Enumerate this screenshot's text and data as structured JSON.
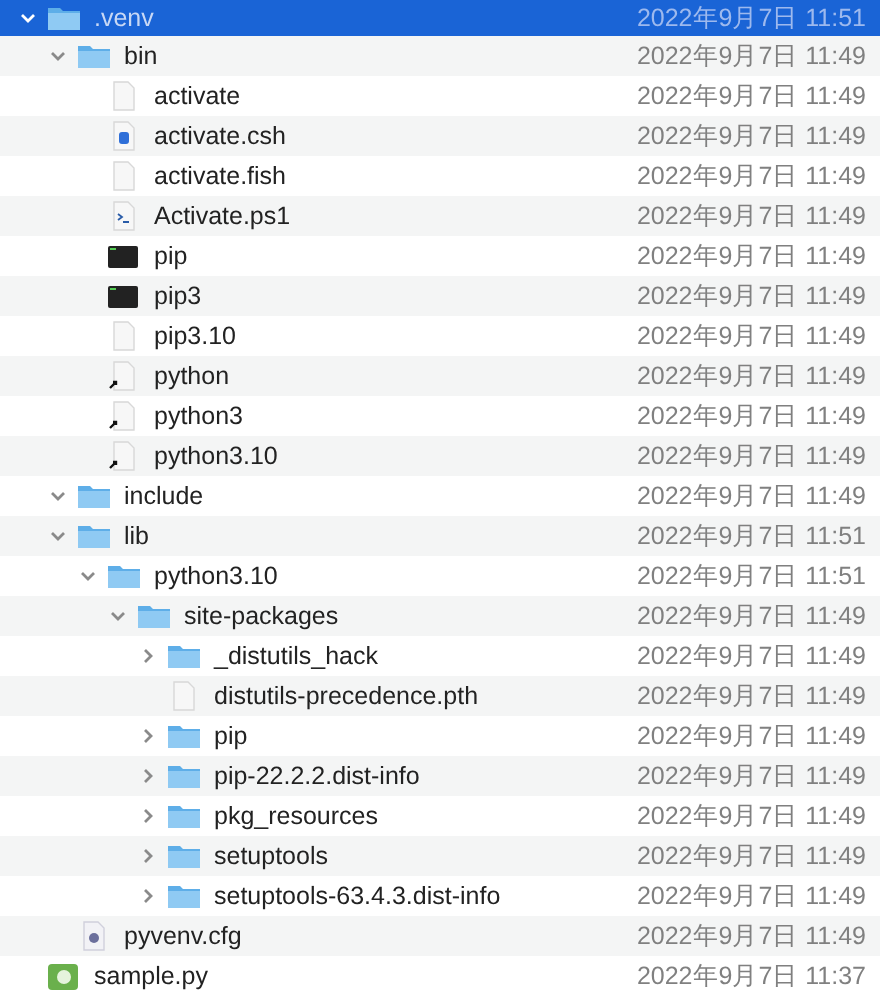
{
  "files": [
    {
      "name": ".venv",
      "date": "2022年9月7日 11:51",
      "kind": "folder",
      "expanded": true,
      "selected": true,
      "children": [
        {
          "name": "bin",
          "date": "2022年9月7日 11:49",
          "kind": "folder",
          "expanded": true,
          "selected": false,
          "children": [
            {
              "name": "activate",
              "date": "2022年9月7日 11:49",
              "kind": "document",
              "selected": false
            },
            {
              "name": "activate.csh",
              "date": "2022年9月7日 11:49",
              "kind": "script",
              "selected": false
            },
            {
              "name": "activate.fish",
              "date": "2022年9月7日 11:49",
              "kind": "document",
              "selected": false
            },
            {
              "name": "Activate.ps1",
              "date": "2022年9月7日 11:49",
              "kind": "shell",
              "selected": false
            },
            {
              "name": "pip",
              "date": "2022年9月7日 11:49",
              "kind": "executable",
              "selected": false
            },
            {
              "name": "pip3",
              "date": "2022年9月7日 11:49",
              "kind": "executable",
              "selected": false
            },
            {
              "name": "pip3.10",
              "date": "2022年9月7日 11:49",
              "kind": "document",
              "selected": false
            },
            {
              "name": "python",
              "date": "2022年9月7日 11:49",
              "kind": "alias",
              "selected": false
            },
            {
              "name": "python3",
              "date": "2022年9月7日 11:49",
              "kind": "alias",
              "selected": false
            },
            {
              "name": "python3.10",
              "date": "2022年9月7日 11:49",
              "kind": "alias",
              "selected": false
            }
          ]
        },
        {
          "name": "include",
          "date": "2022年9月7日 11:49",
          "kind": "folder",
          "expanded": true,
          "selected": false
        },
        {
          "name": "lib",
          "date": "2022年9月7日 11:51",
          "kind": "folder",
          "expanded": true,
          "selected": false,
          "children": [
            {
              "name": "python3.10",
              "date": "2022年9月7日 11:51",
              "kind": "folder",
              "expanded": true,
              "selected": false,
              "children": [
                {
                  "name": "site-packages",
                  "date": "2022年9月7日 11:49",
                  "kind": "folder",
                  "expanded": true,
                  "selected": false,
                  "children": [
                    {
                      "name": "_distutils_hack",
                      "date": "2022年9月7日 11:49",
                      "kind": "folder",
                      "expanded": false,
                      "selected": false
                    },
                    {
                      "name": "distutils-precedence.pth",
                      "date": "2022年9月7日 11:49",
                      "kind": "document",
                      "selected": false
                    },
                    {
                      "name": "pip",
                      "date": "2022年9月7日 11:49",
                      "kind": "folder",
                      "expanded": false,
                      "selected": false
                    },
                    {
                      "name": "pip-22.2.2.dist-info",
                      "date": "2022年9月7日 11:49",
                      "kind": "folder",
                      "expanded": false,
                      "selected": false
                    },
                    {
                      "name": "pkg_resources",
                      "date": "2022年9月7日 11:49",
                      "kind": "folder",
                      "expanded": false,
                      "selected": false
                    },
                    {
                      "name": "setuptools",
                      "date": "2022年9月7日 11:49",
                      "kind": "folder",
                      "expanded": false,
                      "selected": false
                    },
                    {
                      "name": "setuptools-63.4.3.dist-info",
                      "date": "2022年9月7日 11:49",
                      "kind": "folder",
                      "expanded": false,
                      "selected": false
                    }
                  ]
                }
              ]
            }
          ]
        },
        {
          "name": "pyvenv.cfg",
          "date": "2022年9月7日 11:49",
          "kind": "config",
          "selected": false
        }
      ]
    },
    {
      "name": "sample.py",
      "date": "2022年9月7日 11:37",
      "kind": "python",
      "selected": false
    }
  ]
}
